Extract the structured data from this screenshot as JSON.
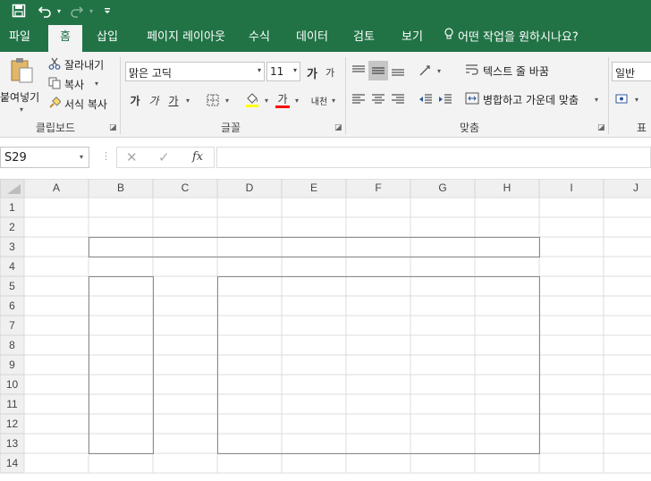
{
  "qat": {
    "save_icon": "save-icon",
    "undo_icon": "undo-icon",
    "redo_icon": "redo-icon",
    "customize_icon": "customize-qat-icon"
  },
  "tabs": [
    {
      "label": "파일"
    },
    {
      "label": "홈"
    },
    {
      "label": "삽입"
    },
    {
      "label": "페이지 레이아웃"
    },
    {
      "label": "수식"
    },
    {
      "label": "데이터"
    },
    {
      "label": "검토"
    },
    {
      "label": "보기"
    }
  ],
  "active_tab": "홈",
  "tell_me": "어떤 작업을 원하시나요?",
  "clipboard": {
    "paste": "붙여넣기",
    "cut": "잘라내기",
    "copy": "복사",
    "format_painter": "서식 복사",
    "group_label": "클립보드"
  },
  "font": {
    "name": "맑은 고딕",
    "size": "11",
    "grow": "가",
    "shrink": "가",
    "bold": "가",
    "italic": "가",
    "underline": "가",
    "font_color": "가",
    "phonetic": "내천",
    "group_label": "글꼴",
    "highlight_color": "#ffff00",
    "text_color": "#ff0000"
  },
  "alignment": {
    "wrap_text": "텍스트 줄 바꿈",
    "merge_center": "병합하고 가운데 맞춤",
    "group_label": "맞춤"
  },
  "number": {
    "format": "일반",
    "group_label": "표"
  },
  "formula_bar": {
    "name_box": "S29",
    "formula": ""
  },
  "sheet": {
    "columns": [
      "A",
      "B",
      "C",
      "D",
      "E",
      "F",
      "G",
      "H",
      "I",
      "J"
    ],
    "rows": [
      "1",
      "2",
      "3",
      "4",
      "5",
      "6",
      "7",
      "8",
      "9",
      "10",
      "11",
      "12",
      "13",
      "14"
    ]
  }
}
